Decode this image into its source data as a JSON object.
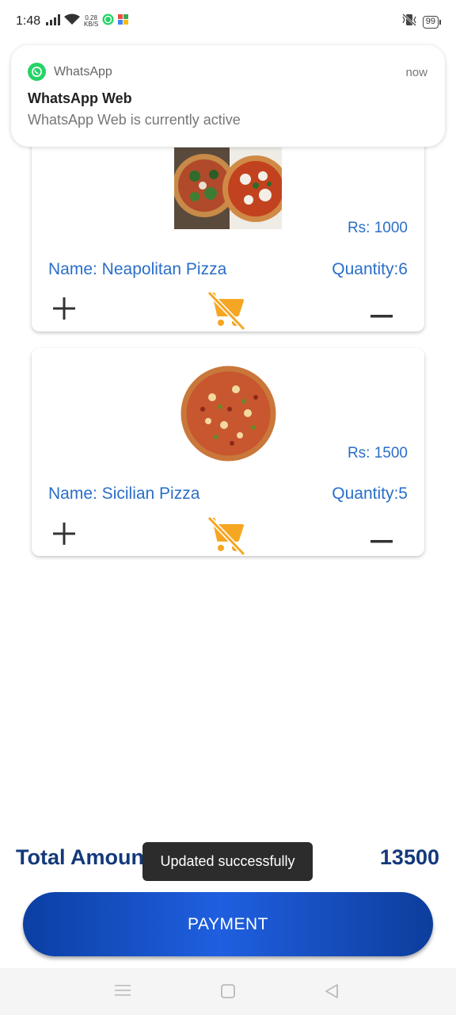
{
  "status_bar": {
    "time": "1:48",
    "net_speed_value": "0.28",
    "net_speed_unit": "KB/S",
    "battery": "99"
  },
  "notification": {
    "app_name": "WhatsApp",
    "time": "now",
    "title": "WhatsApp Web",
    "text": "WhatsApp Web is currently active"
  },
  "cart_items": [
    {
      "price": "Rs: 1000",
      "name": "Name: Neapolitan Pizza",
      "quantity": "Quantity:6"
    },
    {
      "price": "Rs: 1500",
      "name": "Name: Sicilian Pizza",
      "quantity": "Quantity:5"
    }
  ],
  "total": {
    "label": "Total Amount",
    "value": "13500"
  },
  "toast": "Updated successfully",
  "payment_button": "PAYMENT",
  "colors": {
    "accent": "#2a6ec9",
    "dark_blue": "#14397a",
    "cart_icon": "#f5a623"
  }
}
